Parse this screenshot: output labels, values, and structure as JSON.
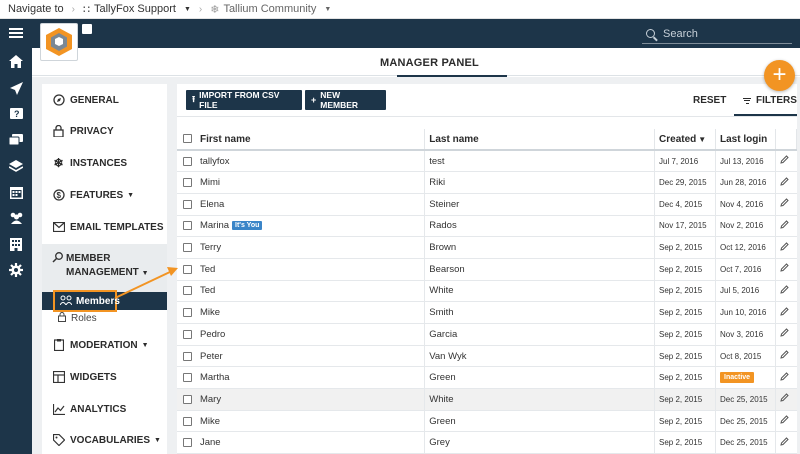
{
  "topnav": {
    "label": "Navigate to",
    "crumbs": [
      "TallyFox Support",
      "Tallium Community"
    ]
  },
  "header": {
    "search_placeholder": "Search"
  },
  "panel": {
    "title": "MANAGER PANEL"
  },
  "menu": {
    "items": [
      "GENERAL",
      "PRIVACY",
      "INSTANCES",
      "FEATURES",
      "EMAIL TEMPLATES",
      "MODERATION",
      "WIDGETS",
      "ANALYTICS",
      "VOCABULARIES"
    ],
    "member_management": [
      "MEMBER",
      "MANAGEMENT"
    ],
    "sub": {
      "members": "Members",
      "roles": "Roles"
    }
  },
  "toolbar": {
    "import_label": "IMPORT FROM CSV FILE",
    "new_member_label": "NEW MEMBER",
    "reset_label": "RESET",
    "filters_label": "FILTERS"
  },
  "table": {
    "columns": [
      "First name",
      "Last name",
      "Created",
      "Last login"
    ],
    "rows": [
      {
        "first": "tallyfox",
        "last": "test",
        "created": "Jul 7, 2016",
        "login": "Jul 13, 2016"
      },
      {
        "first": "Mimi",
        "last": "Riki",
        "created": "Dec 29, 2015",
        "login": "Jun 28, 2016"
      },
      {
        "first": "Elena",
        "last": "Steiner",
        "created": "Dec 4, 2015",
        "login": "Nov 4, 2016"
      },
      {
        "first": "Marina",
        "badge": "It's You",
        "last": "Rados",
        "created": "Nov 17, 2015",
        "login": "Nov 2, 2016"
      },
      {
        "first": "Terry",
        "last": "Brown",
        "created": "Sep 2, 2015",
        "login": "Oct 12, 2016"
      },
      {
        "first": "Ted",
        "last": "Bearson",
        "created": "Sep 2, 2015",
        "login": "Oct 7, 2016"
      },
      {
        "first": "Ted",
        "last": "White",
        "created": "Sep 2, 2015",
        "login": "Jul 5, 2016"
      },
      {
        "first": "Mike",
        "last": "Smith",
        "created": "Sep 2, 2015",
        "login": "Jun 10, 2016"
      },
      {
        "first": "Pedro",
        "last": "Garcia",
        "created": "Sep 2, 2015",
        "login": "Nov 3, 2016"
      },
      {
        "first": "Peter",
        "last": "Van Wyk",
        "created": "Sep 2, 2015",
        "login": "Oct 8, 2015"
      },
      {
        "first": "Martha",
        "last": "Green",
        "created": "Sep 2, 2015",
        "login_badge": "Inactive"
      },
      {
        "first": "Mary",
        "last": "White",
        "created": "Sep 2, 2015",
        "login": "Dec 25, 2015"
      },
      {
        "first": "Mike",
        "last": "Green",
        "created": "Sep 2, 2015",
        "login": "Dec 25, 2015"
      },
      {
        "first": "Jane",
        "last": "Grey",
        "created": "Sep 2, 2015",
        "login": "Dec 25, 2015"
      }
    ]
  },
  "colors": {
    "navy": "#1d3549",
    "accent": "#f29423",
    "badge_blue": "#3a85c8"
  },
  "icons": {
    "rail": [
      "menu-icon",
      "home-icon",
      "paper-plane-icon",
      "question-icon",
      "chat-icon",
      "layers-icon",
      "calendar-icon",
      "people-icon",
      "building-icon",
      "gear-icon"
    ]
  }
}
